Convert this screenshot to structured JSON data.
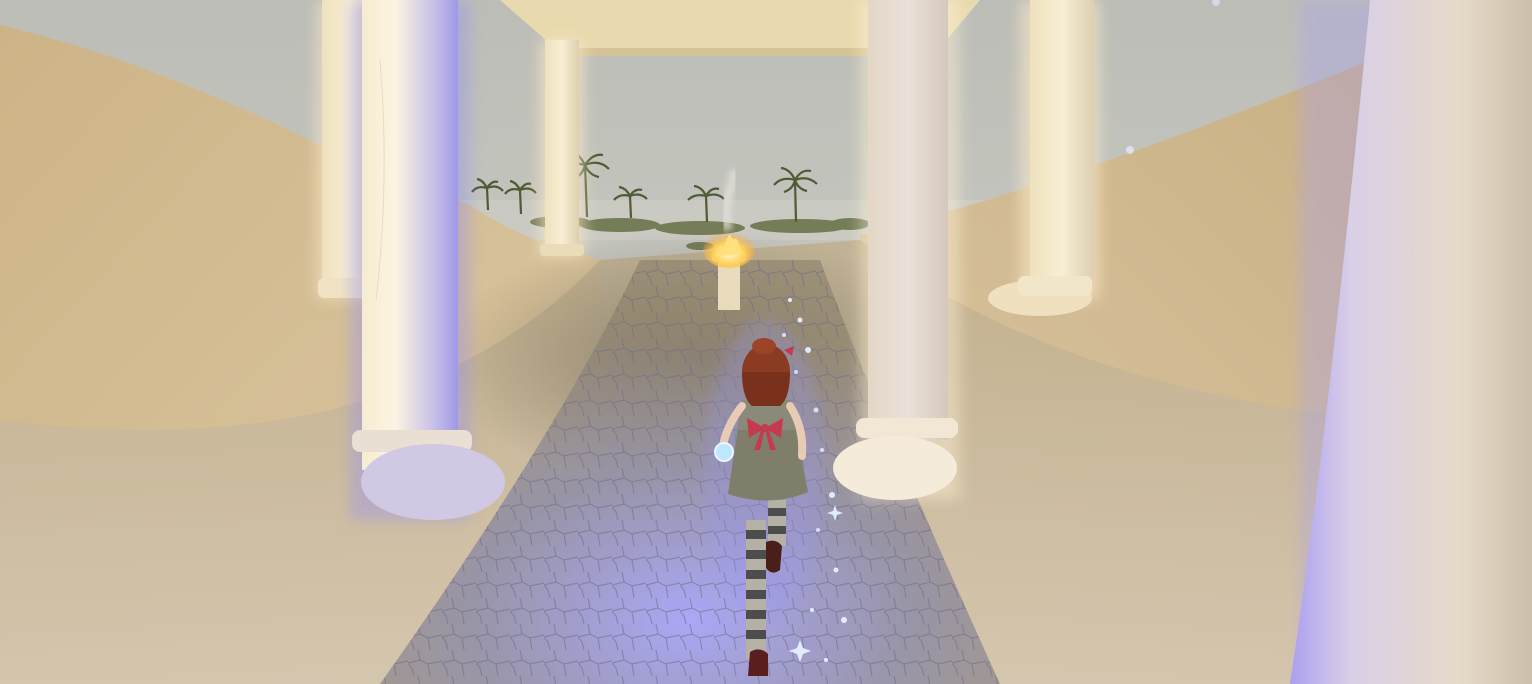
{
  "scene": {
    "kind": "third-person-3d-game-view",
    "setting": "desert-temple-colonnade",
    "palette": {
      "sky": "#c2c3bd",
      "sand_light": "#d9c49b",
      "sand_dark": "#b89e72",
      "path_stone": "#8f8fa4",
      "path_glow": "#9f9cff",
      "column_stone": "#efe3c4",
      "column_glow": "#8a86ff",
      "flame": "#ffcc55",
      "character_hair": "#8a3b22",
      "character_dress": "#7f7e6a",
      "character_bow": "#c43a4e",
      "stocking_stripe_dark": "#4d4d4d",
      "stocking_stripe_light": "#b5b2a5",
      "sparkle": "#d9e6ff"
    }
  }
}
